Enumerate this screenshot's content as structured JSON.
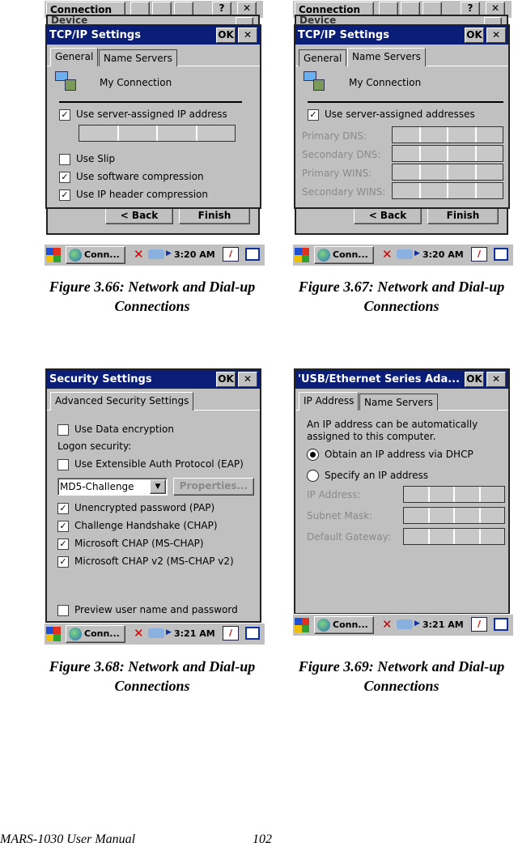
{
  "figures": [
    {
      "caption_line1": "Figure 3.66: Network and Dial-up",
      "caption_line2": "Connections",
      "background": {
        "connection_title": "Connection",
        "help": "?",
        "close": "✕",
        "device_title": "Device"
      },
      "dialog": {
        "title": "TCP/IP Settings",
        "ok": "OK",
        "close": "✕",
        "tabs": [
          "General",
          "Name Servers"
        ],
        "active_tab": "General",
        "connection_name": "My Connection",
        "options": [
          {
            "label": "Use server-assigned IP address",
            "checked": true
          },
          {
            "label": "Use Slip",
            "checked": false
          },
          {
            "label": "Use software compression",
            "checked": true
          },
          {
            "label": "Use IP header compression",
            "checked": true
          }
        ]
      },
      "wizard": {
        "back": "< Back",
        "finish": "Finish"
      },
      "taskbar": {
        "task": "Conn...",
        "time": "3:20 AM"
      }
    },
    {
      "caption_line1": "Figure 3.67: Network and Dial-up",
      "caption_line2": "Connections",
      "background": {
        "connection_title": "Connection",
        "help": "?",
        "close": "✕",
        "device_title": "Device"
      },
      "dialog": {
        "title": "TCP/IP Settings",
        "ok": "OK",
        "close": "✕",
        "tabs": [
          "General",
          "Name Servers"
        ],
        "active_tab": "Name Servers",
        "connection_name": "My Connection",
        "option": {
          "label": "Use server-assigned addresses",
          "checked": true
        },
        "fields": [
          "Primary DNS:",
          "Secondary DNS:",
          "Primary WINS:",
          "Secondary WINS:"
        ]
      },
      "wizard": {
        "back": "< Back",
        "finish": "Finish"
      },
      "taskbar": {
        "task": "Conn...",
        "time": "3:20 AM"
      }
    },
    {
      "caption_line1": "Figure 3.68: Network and Dial-up",
      "caption_line2": "Connections",
      "dialog": {
        "title": "Security Settings",
        "ok": "OK",
        "close": "✕",
        "tabs": [
          "Advanced Security Settings"
        ],
        "data_encryption": {
          "label": "Use Data encryption",
          "checked": false
        },
        "logon_security": "Logon security:",
        "eap": {
          "label": "Use Extensible Auth Protocol (EAP)",
          "checked": false
        },
        "eap_method": "MD5-Challenge",
        "properties": "Properties...",
        "protocols": [
          {
            "label": "Unencrypted password (PAP)",
            "checked": true
          },
          {
            "label": "Challenge Handshake  (CHAP)",
            "checked": true
          },
          {
            "label": "Microsoft CHAP (MS-CHAP)",
            "checked": true
          },
          {
            "label": "Microsoft CHAP v2 (MS-CHAP v2)",
            "checked": true
          }
        ],
        "preview": {
          "label": "Preview user name and password",
          "checked": false
        }
      },
      "taskbar": {
        "task": "Conn...",
        "time": "3:21 AM"
      }
    },
    {
      "caption_line1": "Figure 3.69: Network and Dial-up",
      "caption_line2": "Connections",
      "dialog": {
        "title": "'USB/Ethernet Series Ada...",
        "ok": "OK",
        "close": "✕",
        "tabs": [
          "IP Address",
          "Name Servers"
        ],
        "active_tab": "IP Address",
        "description": "An IP address can be automatically assigned to this computer.",
        "radios": [
          {
            "label": "Obtain an IP address via DHCP",
            "selected": true
          },
          {
            "label": "Specify an IP address",
            "selected": false
          }
        ],
        "fields": [
          "IP Address:",
          "Subnet Mask:",
          "Default Gateway:"
        ]
      },
      "taskbar": {
        "task": "Conn...",
        "time": "3:21 AM"
      }
    }
  ],
  "footer": {
    "manual": "MARS-1030 User Manual",
    "page": "102"
  }
}
